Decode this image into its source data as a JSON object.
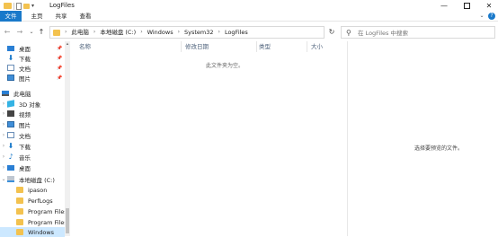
{
  "window": {
    "title": "LogFiles"
  },
  "ribbon": {
    "tabs": [
      "文件",
      "主页",
      "共享",
      "查看"
    ]
  },
  "address": {
    "crumbs": [
      "此电脑",
      "本地磁盘 (C:)",
      "Windows",
      "System32",
      "LogFiles"
    ]
  },
  "search": {
    "placeholder": "在 LogFiles 中搜索"
  },
  "sidebar": {
    "items": [
      {
        "label": "桌面",
        "icon": "desktop-icon",
        "pinned": true
      },
      {
        "label": "下载",
        "icon": "download-icon",
        "pinned": true
      },
      {
        "label": "文档",
        "icon": "document-icon",
        "pinned": true
      },
      {
        "label": "图片",
        "icon": "picture-icon",
        "pinned": true
      },
      {
        "label": "此电脑",
        "icon": "computer-icon"
      },
      {
        "label": "3D 对象",
        "icon": "3d-objects-icon"
      },
      {
        "label": "视频",
        "icon": "video-icon"
      },
      {
        "label": "图片",
        "icon": "picture-icon"
      },
      {
        "label": "文档",
        "icon": "document-icon"
      },
      {
        "label": "下载",
        "icon": "download-icon"
      },
      {
        "label": "音乐",
        "icon": "music-icon"
      },
      {
        "label": "桌面",
        "icon": "desktop-icon"
      },
      {
        "label": "本地磁盘 (C:)",
        "icon": "drive-icon"
      },
      {
        "label": "ipason",
        "icon": "folder-icon"
      },
      {
        "label": "PerfLogs",
        "icon": "folder-icon"
      },
      {
        "label": "Program Files",
        "icon": "folder-icon"
      },
      {
        "label": "Program Files",
        "icon": "folder-icon"
      },
      {
        "label": "Windows",
        "icon": "folder-icon",
        "selected": true
      }
    ]
  },
  "columns": {
    "name": "名称",
    "date": "修改日期",
    "type": "类型",
    "size": "大小"
  },
  "content": {
    "empty_message": "此文件夹为空。"
  },
  "preview": {
    "message": "选择要预览的文件。"
  },
  "colors": {
    "accent": "#1979ca",
    "selection": "#cce8ff",
    "folder": "#f3c24f"
  }
}
